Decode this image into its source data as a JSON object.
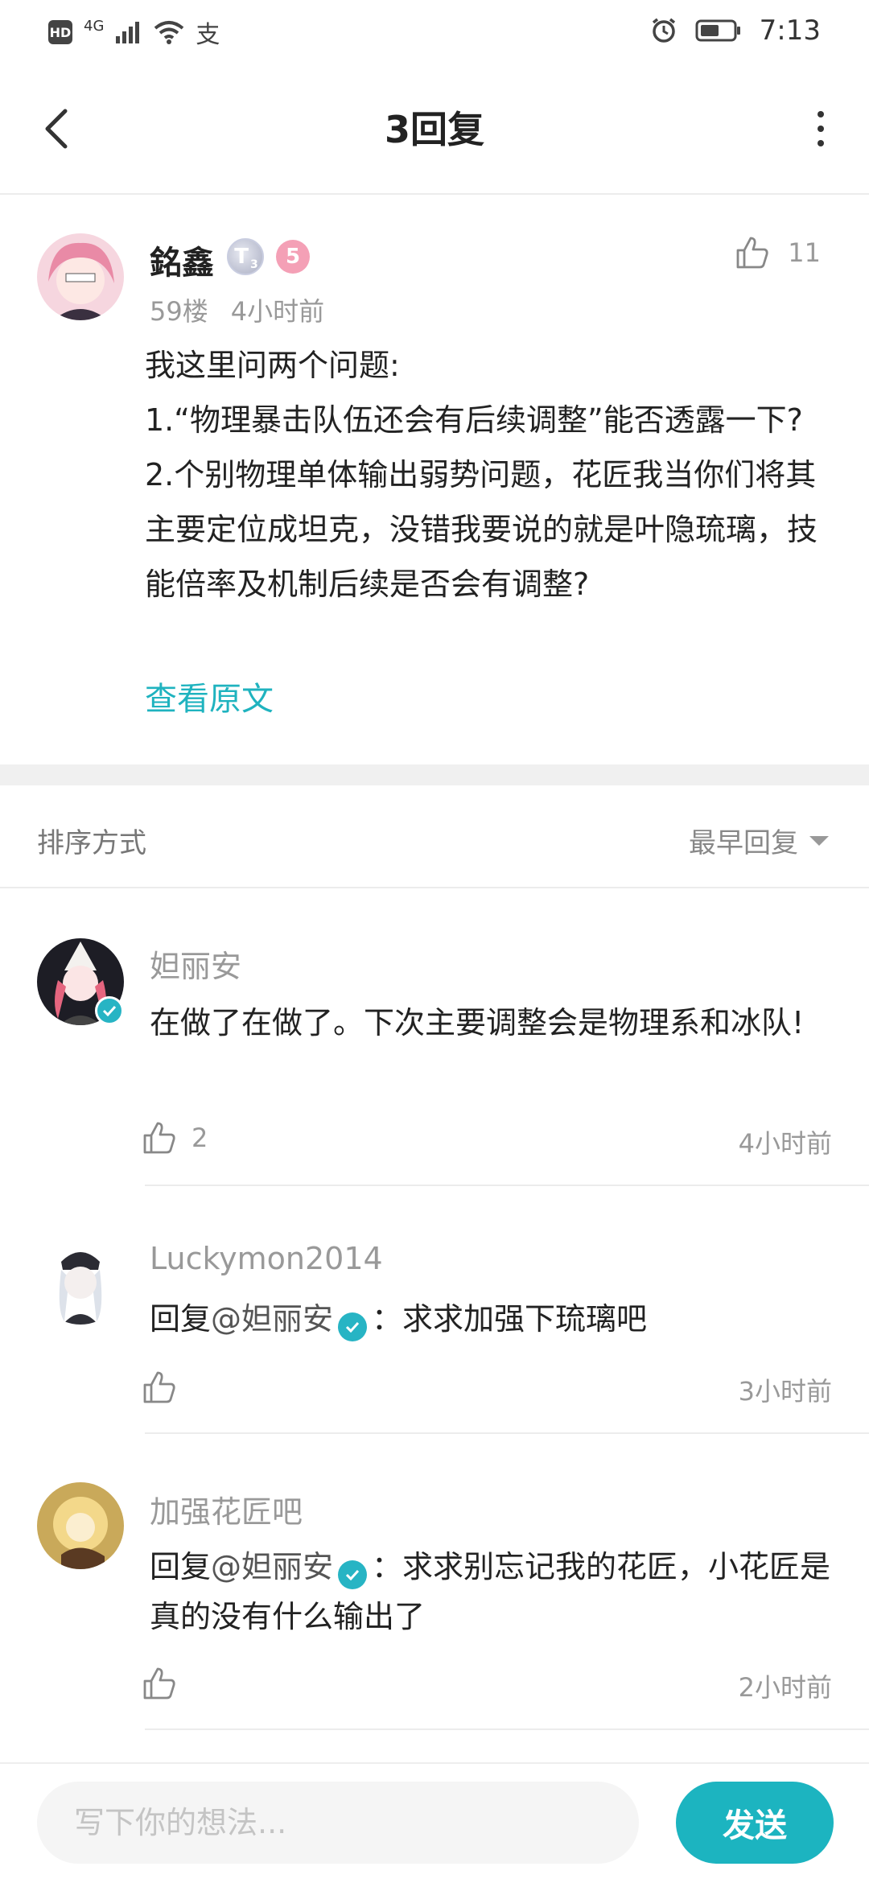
{
  "status_bar": {
    "hd": "HD",
    "network": "4G",
    "alipay_glyph": "支",
    "time": "7:13",
    "icons": [
      "signal-icon",
      "wifi-icon",
      "alarm-icon",
      "battery-icon"
    ]
  },
  "header": {
    "title": "3回复",
    "back_icon": "chevron-left-icon",
    "more_icon": "more-vertical-icon"
  },
  "post": {
    "author": "銘鑫",
    "badge_level": "T",
    "badge_sub": "3",
    "badge_fan": "5",
    "floor": "59楼",
    "time": "4小时前",
    "likes": "11",
    "lines": [
      "我这里问两个问题:",
      "1.“物理暴击队伍还会有后续调整”能否透露一下?",
      "2.个别物理单体输出弱势问题，花匠我当你们将其主要定位成坦克，没错我要说的就是叶隐琉璃，技能倍率及机制后续是否会有调整?"
    ],
    "view_original": "查看原文"
  },
  "sort": {
    "label": "排序方式",
    "selected": "最早回复"
  },
  "replies": [
    {
      "name": "妲丽安",
      "text": "在做了在做了。下次主要调整会是物理系和冰队!",
      "likes": "2",
      "time": "4小时前",
      "verified": true
    },
    {
      "name": "Luckymon2014",
      "reply_prefix": "回复",
      "mention": "@妲丽安",
      "text": "：求求加强下琉璃吧",
      "likes": "",
      "time": "3小时前"
    },
    {
      "name": "加强花匠吧",
      "reply_prefix": "回复",
      "mention": "@妲丽安",
      "text": "：求求别忘记我的花匠，小花匠是真的没有什么输出了",
      "likes": "",
      "time": "2小时前"
    }
  ],
  "composer": {
    "placeholder": "写下你的想法...",
    "send_label": "发送"
  },
  "colors": {
    "accent": "#1cb4c0",
    "link": "#1fb3bf",
    "muted": "#999999"
  }
}
